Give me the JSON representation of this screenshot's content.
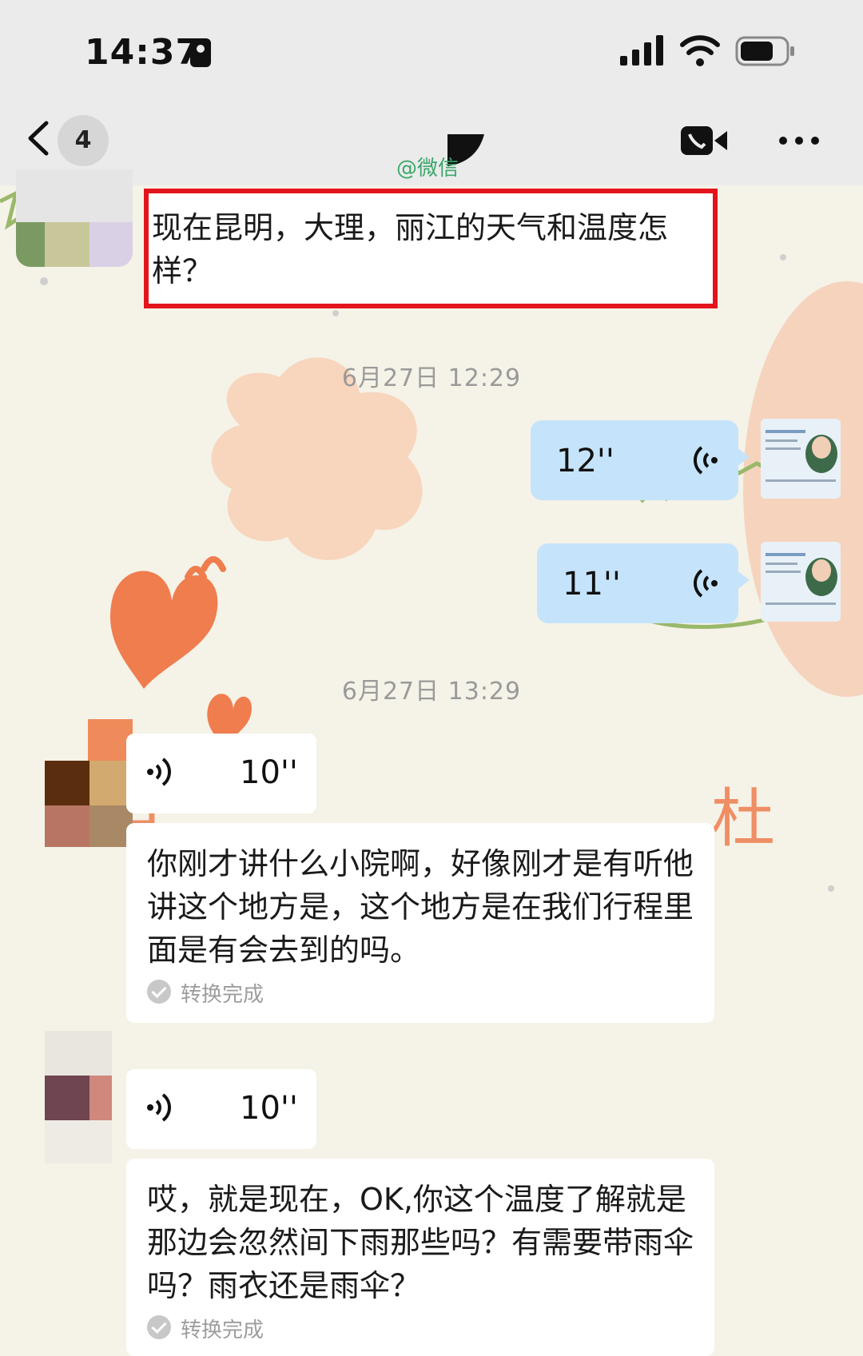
{
  "status_bar": {
    "time": "14:37"
  },
  "nav": {
    "unread_count": "4",
    "watermark": "@微信"
  },
  "messages": [
    {
      "text": "现在昆明，大理，丽江的天气和温度怎样？"
    },
    {
      "timestamp": "6月27日 12:29"
    },
    {
      "duration": "12''"
    },
    {
      "duration": "11''"
    },
    {
      "timestamp": "6月27日 13:29"
    },
    {
      "duration": "10''"
    },
    {
      "text": "你刚才讲什么小院啊，好像刚才是有听他讲这个地方是，这个地方是在我们行程里面是有会去到的吗。",
      "status": "转换完成"
    },
    {
      "duration": "10''"
    },
    {
      "text": "哎，就是现在，OK,你这个温度了解就是那边会忽然间下雨那些吗？有需要带雨伞吗？雨衣还是雨伞？",
      "status": "转换完成"
    }
  ],
  "colors": {
    "highlight": "#e3141b",
    "sent_bubble": "#c5e4fb",
    "received_bubble": "#ffffff",
    "watermark": "#3aa86a"
  },
  "icons": [
    "back-icon",
    "video-call-icon",
    "more-icon",
    "signal-icon",
    "wifi-icon",
    "battery-icon",
    "voice-wave-icon",
    "check-icon"
  ]
}
